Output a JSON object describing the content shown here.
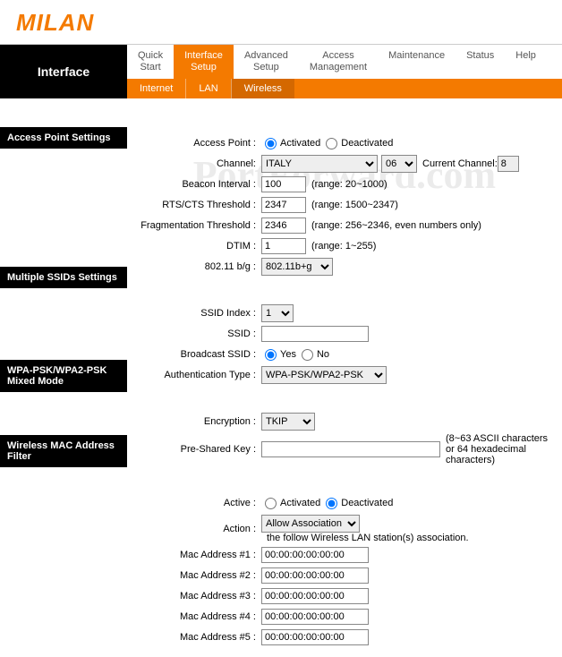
{
  "brand": "MILAN",
  "watermark": "PortForward.com",
  "topbar": {
    "active_left": "Interface",
    "tabs": [
      {
        "label": "Quick\nStart"
      },
      {
        "label": "Interface\nSetup"
      },
      {
        "label": "Advanced\nSetup"
      },
      {
        "label": "Access\nManagement"
      },
      {
        "label": "Maintenance"
      },
      {
        "label": "Status"
      },
      {
        "label": "Help"
      }
    ],
    "subtabs": [
      {
        "label": "Internet"
      },
      {
        "label": "LAN"
      },
      {
        "label": "Wireless"
      }
    ]
  },
  "sections": {
    "ap": "Access Point Settings",
    "ssid": "Multiple SSIDs Settings",
    "wpa": "WPA-PSK/WPA2-PSK Mixed Mode",
    "mac": "Wireless MAC Address Filter"
  },
  "ap": {
    "access_point_label": "Access Point :",
    "activated": "Activated",
    "deactivated": "Deactivated",
    "channel_label": "Channel:",
    "channel_country": "ITALY",
    "channel_num": "06",
    "current_channel_label": "Current Channel:",
    "current_channel": "8",
    "beacon_label": "Beacon Interval :",
    "beacon_value": "100",
    "beacon_hint": "(range: 20~1000)",
    "rts_label": "RTS/CTS Threshold :",
    "rts_value": "2347",
    "rts_hint": "(range: 1500~2347)",
    "frag_label": "Fragmentation Threshold :",
    "frag_value": "2346",
    "frag_hint": "(range: 256~2346, even numbers only)",
    "dtim_label": "DTIM :",
    "dtim_value": "1",
    "dtim_hint": "(range: 1~255)",
    "bg_label": "802.11 b/g :",
    "bg_value": "802.11b+g"
  },
  "ssid": {
    "index_label": "SSID Index :",
    "index_value": "1",
    "ssid_label": "SSID :",
    "ssid_value": "",
    "broadcast_label": "Broadcast SSID :",
    "yes": "Yes",
    "no": "No",
    "auth_label": "Authentication Type :",
    "auth_value": "WPA-PSK/WPA2-PSK"
  },
  "wpa": {
    "enc_label": "Encryption :",
    "enc_value": "TKIP",
    "psk_label": "Pre-Shared Key :",
    "psk_value": "",
    "psk_hint": "(8~63 ASCII characters or 64 hexadecimal characters)"
  },
  "mac": {
    "active_label": "Active :",
    "activated": "Activated",
    "deactivated": "Deactivated",
    "action_label": "Action :",
    "action_value": "Allow Association",
    "action_hint": "the follow Wireless LAN station(s) association.",
    "addr1_label": "Mac Address #1 :",
    "addr2_label": "Mac Address #2 :",
    "addr3_label": "Mac Address #3 :",
    "addr4_label": "Mac Address #4 :",
    "addr5_label": "Mac Address #5 :",
    "addr_value": "00:00:00:00:00:00"
  }
}
